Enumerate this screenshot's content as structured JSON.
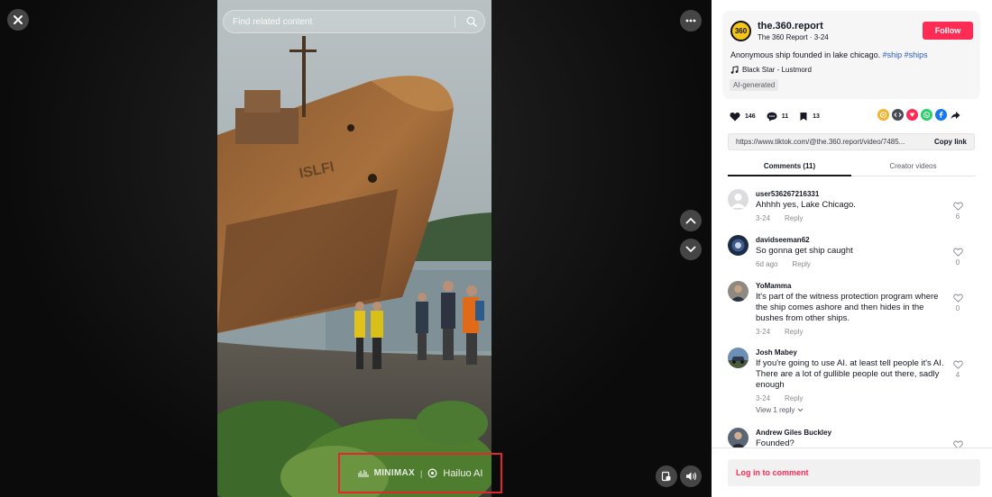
{
  "video": {
    "search_placeholder": "Find related content",
    "watermark": {
      "brand": "MINIMAX",
      "separator": "|",
      "product": "Hailuo AI"
    }
  },
  "post": {
    "avatar_text": "360",
    "author_handle": "the.360.report",
    "author_meta": "The 360 Report · 3-24",
    "follow_label": "Follow",
    "caption_text": "Anonymous ship founded in lake chicago.",
    "hashtags": [
      "#ship",
      "#ships"
    ],
    "music": "Black Star - Lustmord",
    "ai_label": "AI-generated",
    "likes": "146",
    "comments_count": "11",
    "saves": "13",
    "url": "https://www.tiktok.com/@the.360.report/video/7485...",
    "copy_label": "Copy link"
  },
  "tabs": [
    {
      "label": "Comments (11)",
      "active": true
    },
    {
      "label": "Creator videos",
      "active": false
    }
  ],
  "comments": [
    {
      "user": "user536267216331",
      "lines": [
        "Ahhhh yes, Lake Chicago."
      ],
      "date": "3-24",
      "reply": "Reply",
      "likes": "6",
      "avatar": "default"
    },
    {
      "user": "davidseeman62",
      "lines": [
        "So gonna get ship caught"
      ],
      "date": "6d ago",
      "reply": "Reply",
      "likes": "0",
      "avatar": "dark"
    },
    {
      "user": "YoMamma",
      "lines": [
        "It's part of the witness protection program where",
        "the ship comes ashore and then hides in the",
        "bushes from other ships."
      ],
      "date": "3-24",
      "reply": "Reply",
      "likes": "0",
      "avatar": "person"
    },
    {
      "user": "Josh Mabey",
      "lines": [
        "If you're going to use AI. at least tell people it's AI.",
        "There are a lot of gullible people out there, sadly",
        "enough"
      ],
      "date": "3-24",
      "reply": "Reply",
      "likes": "4",
      "avatar": "car",
      "view_replies": "View 1 reply"
    },
    {
      "user": "Andrew Giles Buckley",
      "lines": [
        "Founded?"
      ],
      "date": "",
      "reply": "",
      "likes": "",
      "avatar": "person2"
    }
  ],
  "login_prompt": "Log in to comment",
  "colors": {
    "brand_red": "#fe2c55",
    "hashtag_blue": "#2b5db9",
    "watermark_outline": "#e0272c"
  },
  "icons": [
    "close-icon",
    "more-icon",
    "search-icon",
    "chevron-up-icon",
    "chevron-down-icon",
    "floating-player-icon",
    "volume-icon",
    "music-note-icon",
    "heart-icon",
    "comment-icon",
    "bookmark-icon",
    "share-icon"
  ]
}
